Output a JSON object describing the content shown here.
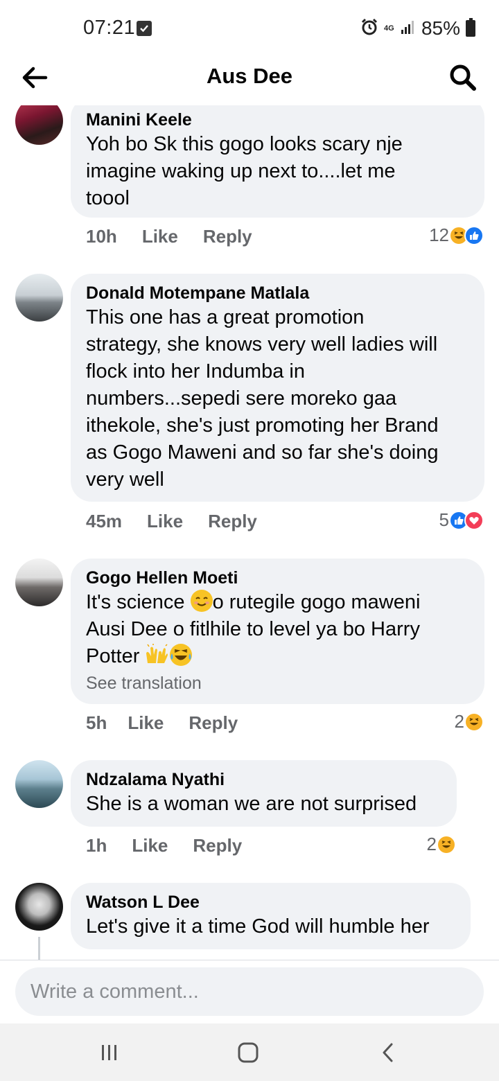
{
  "status": {
    "time": "07:21",
    "network": "4G",
    "battery": "85%"
  },
  "header": {
    "title": "Aus Dee"
  },
  "comments": [
    {
      "author": "Manini Keele",
      "lines": [
        "Yoh bo Sk this gogo looks scary nje",
        "imagine waking up next to....let me",
        "toool"
      ],
      "time": "10h",
      "like": "Like",
      "reply": "Reply",
      "reaction_count": "12",
      "reaction_icons": [
        "haha-icon",
        "like-icon"
      ]
    },
    {
      "author": "Donald Motempane Matlala",
      "lines": [
        "This one has a great promotion",
        "strategy, she knows very well ladies will",
        "flock into her Indumba in",
        "numbers...sepedi sere moreko gaa",
        "ithekole, she's just promoting her Brand",
        "as Gogo Maweni and so far she's doing",
        "very well"
      ],
      "time": "45m",
      "like": "Like",
      "reply": "Reply",
      "reaction_count": "5",
      "reaction_icons": [
        "like-icon",
        "love-icon"
      ]
    },
    {
      "author": "Gogo Hellen Moeti",
      "line1_before": "It's science ",
      "line1_after": "o rutegile gogo maweni",
      "line2": "Ausi Dee o fitlhile to level ya bo Harry",
      "line3": "Potter ",
      "see_translation": "See translation",
      "time": "5h",
      "like": "Like",
      "reply": "Reply",
      "reaction_count": "2",
      "reaction_icons": [
        "haha-icon"
      ]
    },
    {
      "author": "Ndzalama Nyathi",
      "lines": [
        "She is a woman we are not surprised"
      ],
      "time": "1h",
      "like": "Like",
      "reply": "Reply",
      "reaction_count": "2",
      "reaction_icons": [
        "haha-icon"
      ]
    },
    {
      "author": "Watson L Dee",
      "lines": [
        "Let's give it a time God will humble her"
      ]
    }
  ],
  "composer": {
    "placeholder": "Write a comment..."
  },
  "colors": {
    "bubble": "#f0f2f5",
    "meta_text": "#65676b",
    "like_blue": "#1877f2",
    "love_red": "#f33e58",
    "haha_yellow": "#f7b125"
  }
}
